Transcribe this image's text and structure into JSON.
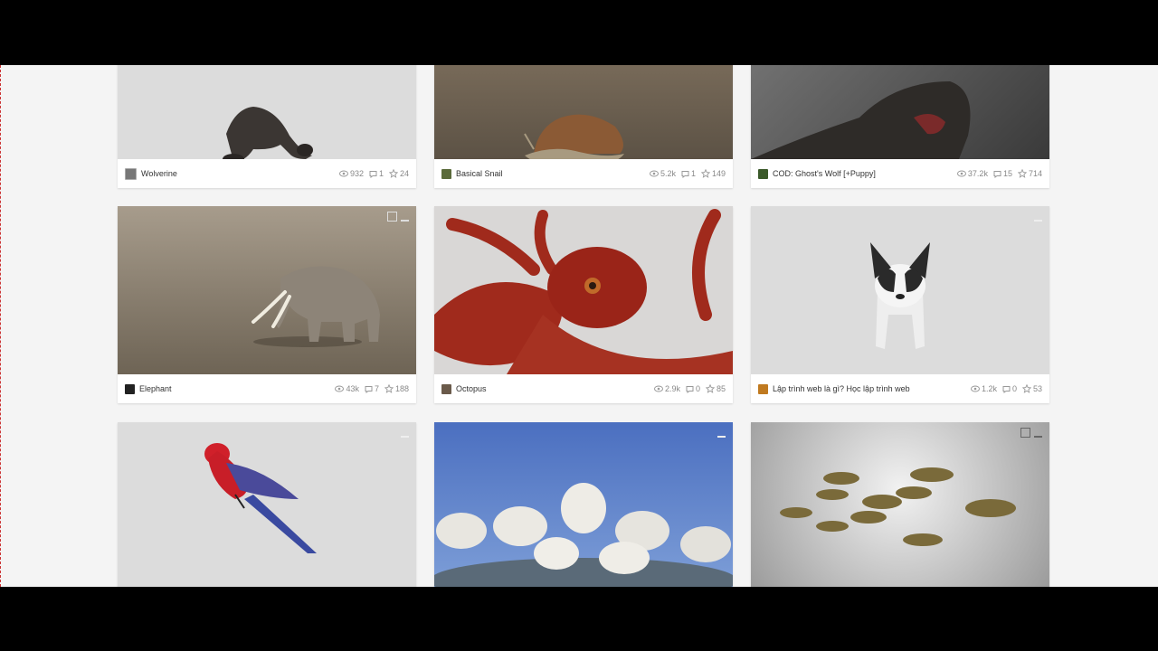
{
  "cards": [
    {
      "title": "Wolverine",
      "views": "932",
      "comments": "1",
      "likes": "24",
      "avatar_color": "#777777"
    },
    {
      "title": "Basical Snail",
      "views": "5.2k",
      "comments": "1",
      "likes": "149",
      "avatar_color": "#5a6a3a"
    },
    {
      "title": "COD: Ghost's Wolf [+Puppy]",
      "views": "37.2k",
      "comments": "15",
      "likes": "714",
      "avatar_color": "#3b5a2a"
    },
    {
      "title": "Elephant",
      "views": "43k",
      "comments": "7",
      "likes": "188",
      "avatar_color": "#222222"
    },
    {
      "title": "Octopus",
      "views": "2.9k",
      "comments": "0",
      "likes": "85",
      "avatar_color": "#6a5a4a"
    },
    {
      "title": "Lập trình web là gì? Học lập trình web",
      "views": "1.2k",
      "comments": "0",
      "likes": "53",
      "avatar_color": "#c07a20"
    },
    {
      "title": "",
      "views": "",
      "comments": "",
      "likes": "",
      "avatar_color": "#999999"
    },
    {
      "title": "",
      "views": "",
      "comments": "",
      "likes": "",
      "avatar_color": "#999999"
    },
    {
      "title": "",
      "views": "",
      "comments": "",
      "likes": "",
      "avatar_color": "#999999"
    }
  ],
  "icons": {
    "views": "eye-icon",
    "comments": "comment-icon",
    "likes": "star-icon",
    "download": "download-icon",
    "gallery": "gallery-icon"
  }
}
